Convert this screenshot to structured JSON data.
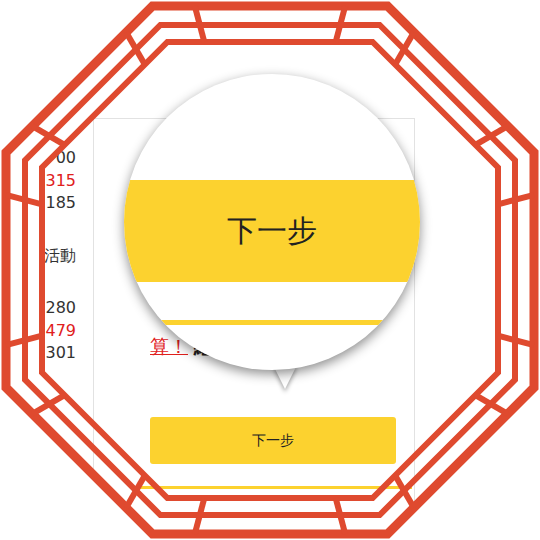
{
  "left_column": {
    "groups": [
      [
        {
          "text": "00",
          "color": "#333333"
        },
        {
          "text": "315",
          "color": "#e0201c"
        },
        {
          "text": "185",
          "color": "#333333"
        }
      ],
      [
        {
          "text": "活動",
          "color": "#333333"
        }
      ],
      [
        {
          "text": "280",
          "color": "#333333"
        },
        {
          "text": "479",
          "color": "#e0201c"
        },
        {
          "text": "301",
          "color": "#333333"
        }
      ]
    ]
  },
  "card": {
    "link": "算！",
    "title": "繼續選購"
  },
  "button": {
    "label": "下一步"
  },
  "magnifier": {
    "label": "下一步"
  }
}
